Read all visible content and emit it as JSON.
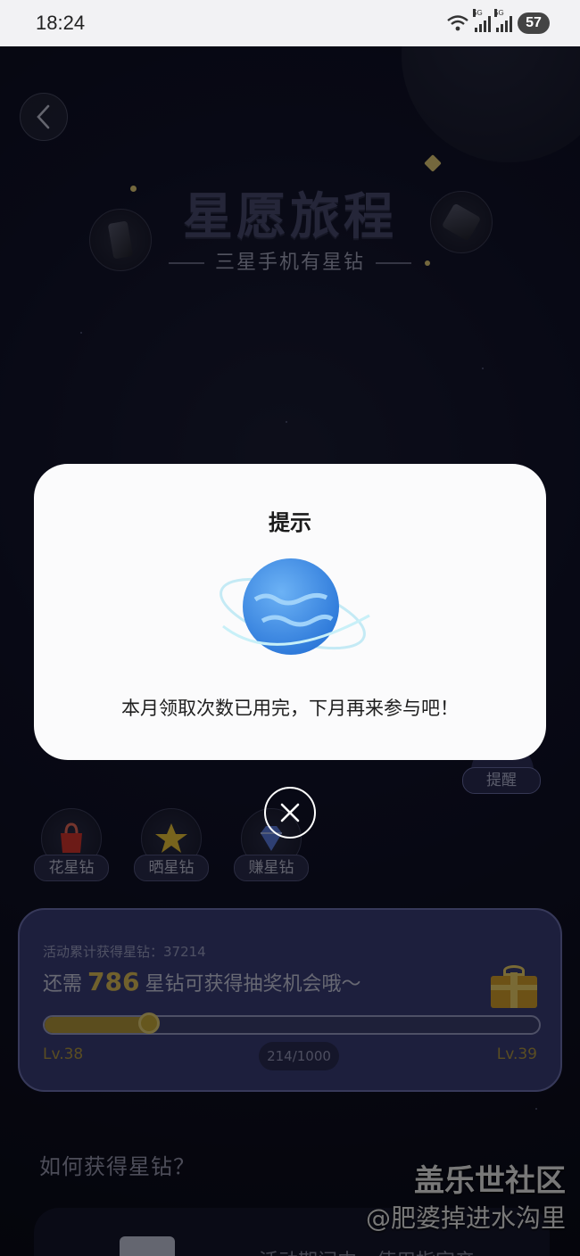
{
  "status_bar": {
    "time": "18:24",
    "signal1_tag": "5G",
    "signal2_tag": "5G",
    "battery": "57"
  },
  "hero": {
    "title": "星愿旅程",
    "subtitle": "三星手机有星钻"
  },
  "remind": {
    "label": "提醒"
  },
  "actions": [
    {
      "label": "花星钻",
      "icon": "shopping-bag-icon"
    },
    {
      "label": "晒星钻",
      "icon": "star-icon"
    },
    {
      "label": "赚星钻",
      "icon": "diamond-icon"
    }
  ],
  "progress": {
    "accumulated_label": "活动累计获得星钻：37214",
    "need_prefix": "还需",
    "need_amount": "786",
    "need_suffix": "星钻可获得抽奖机会哦～",
    "level_current": "Lv.38",
    "level_next": "Lv.39",
    "fraction_text": "214/1000",
    "fraction": 0.214
  },
  "how": {
    "title": "如何获得星钻？",
    "snippet": "活动期间内，使用指定产"
  },
  "watermark": {
    "line1": "盖乐世社区",
    "line2": "@肥婆掉进水沟里"
  },
  "dialog": {
    "title": "提示",
    "message": "本月领取次数已用完，下月再来参与吧！"
  },
  "colors": {
    "accent_gold": "#e2c25a",
    "card_purple": "#3b3f7a",
    "planet_blue": "#3a86e0"
  }
}
